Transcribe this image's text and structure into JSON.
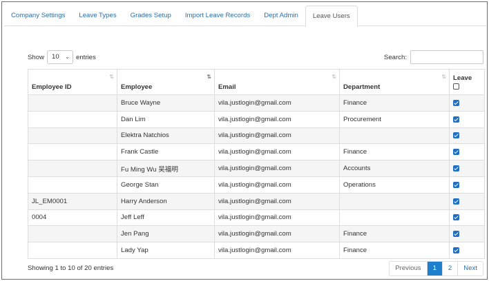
{
  "tabs": [
    {
      "label": "Company Settings",
      "active": false
    },
    {
      "label": "Leave Types",
      "active": false
    },
    {
      "label": "Grades Setup",
      "active": false
    },
    {
      "label": "Import Leave Records",
      "active": false
    },
    {
      "label": "Dept Admin",
      "active": false
    },
    {
      "label": "Leave Users",
      "active": true
    }
  ],
  "length_control": {
    "prefix": "Show",
    "value": "10",
    "suffix": "entries"
  },
  "search": {
    "label": "Search:",
    "value": "",
    "placeholder": ""
  },
  "table": {
    "columns": [
      "Employee ID",
      "Employee",
      "Email",
      "Department",
      "Leave"
    ],
    "sorted_column": "Employee",
    "leave_header_checked": false,
    "rows": [
      {
        "employee_id": "",
        "employee": "Bruce Wayne",
        "email": "vila.justlogin@gmail.com",
        "department": "Finance",
        "leave": true
      },
      {
        "employee_id": "",
        "employee": "Dan Lim",
        "email": "vila.justlogin@gmail.com",
        "department": "Procurement",
        "leave": true
      },
      {
        "employee_id": "",
        "employee": "Elektra Natchios",
        "email": "vila.justlogin@gmail.com",
        "department": "",
        "leave": true
      },
      {
        "employee_id": "",
        "employee": "Frank Castle",
        "email": "vila.justlogin@gmail.com",
        "department": "Finance",
        "leave": true
      },
      {
        "employee_id": "",
        "employee": "Fu Ming Wu 吴福明",
        "email": "vila.justlogin@gmail.com",
        "department": "Accounts",
        "leave": true
      },
      {
        "employee_id": "",
        "employee": "George Stan",
        "email": "vila.justlogin@gmail.com",
        "department": "Operations",
        "leave": true
      },
      {
        "employee_id": "JL_EM0001",
        "employee": "Harry Anderson",
        "email": "vila.justlogin@gmail.com",
        "department": "",
        "leave": true
      },
      {
        "employee_id": "0004",
        "employee": "Jeff Leff",
        "email": "vila.justlogin@gmail.com",
        "department": "",
        "leave": true
      },
      {
        "employee_id": "",
        "employee": "Jen Pang",
        "email": "vila.justlogin@gmail.com",
        "department": "Finance",
        "leave": true
      },
      {
        "employee_id": "",
        "employee": "Lady Yap",
        "email": "vila.justlogin@gmail.com",
        "department": "Finance",
        "leave": true
      }
    ]
  },
  "info_text": "Showing 1 to 10 of 20 entries",
  "pagination": {
    "previous": "Previous",
    "pages": [
      "1",
      "2"
    ],
    "current": "1",
    "next": "Next"
  },
  "colors": {
    "accent": "#1f7fcf",
    "link": "#2a6ea8",
    "checkbox": "#1f6fc5"
  }
}
